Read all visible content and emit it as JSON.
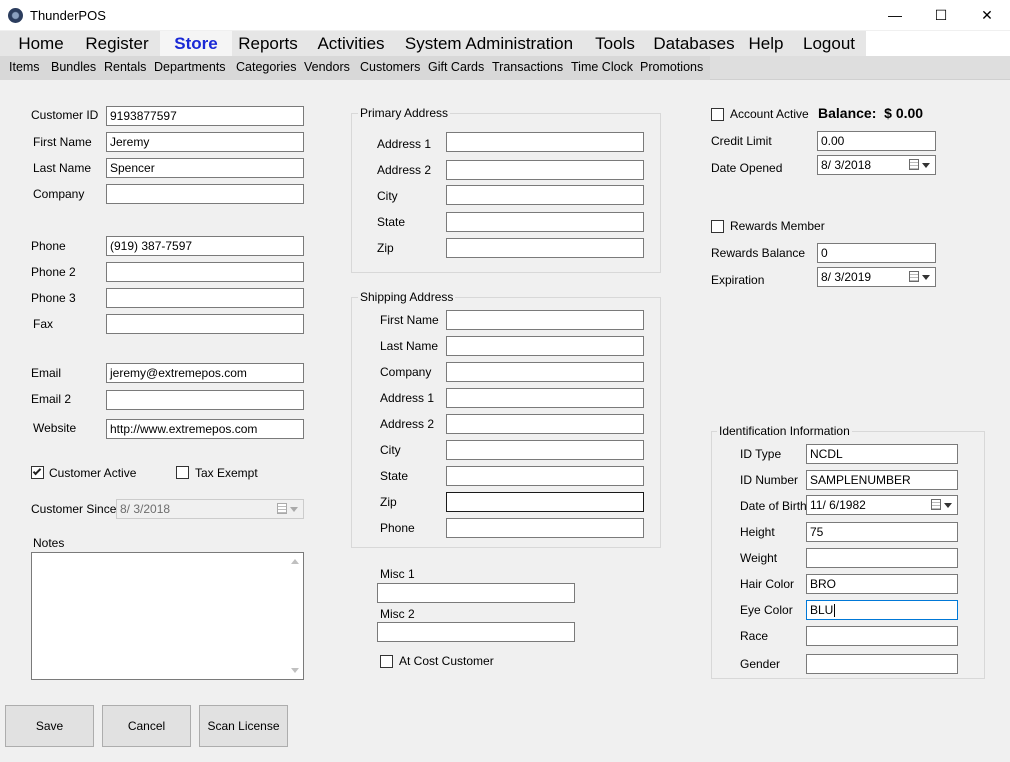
{
  "window": {
    "title": "ThunderPOS",
    "minimize": "—",
    "maximize": "☐",
    "close": "✕"
  },
  "main_menu": [
    "Home",
    "Register",
    "Store",
    "Reports",
    "Activities",
    "System Administration",
    "Tools",
    "Databases",
    "Help",
    "Logout"
  ],
  "main_menu_active": "Store",
  "sub_menu": [
    "Items",
    "Bundles",
    "Rentals",
    "Departments",
    "Categories",
    "Vendors",
    "Customers",
    "Gift Cards",
    "Transactions",
    "Time Clock",
    "Promotions"
  ],
  "customer": {
    "id_label": "Customer ID",
    "id": "9193877597",
    "first_name_label": "First Name",
    "first_name": "Jeremy",
    "last_name_label": "Last Name",
    "last_name": "Spencer",
    "company_label": "Company",
    "company": "",
    "phone_label": "Phone",
    "phone": "(919) 387-7597",
    "phone2_label": "Phone 2",
    "phone2": "",
    "phone3_label": "Phone 3",
    "phone3": "",
    "fax_label": "Fax",
    "fax": "",
    "email_label": "Email",
    "email": "jeremy@extremepos.com",
    "email2_label": "Email 2",
    "email2": "",
    "website_label": "Website",
    "website": "http://www.extremepos.com",
    "active_label": "Customer Active",
    "active": true,
    "tax_exempt_label": "Tax Exempt",
    "tax_exempt": false,
    "since_label": "Customer Since",
    "since": "8/  3/2018",
    "notes_label": "Notes",
    "notes": ""
  },
  "primary_address": {
    "title": "Primary Address",
    "address1_label": "Address 1",
    "address1": "",
    "address2_label": "Address 2",
    "address2": "",
    "city_label": "City",
    "city": "",
    "state_label": "State",
    "state": "",
    "zip_label": "Zip",
    "zip": ""
  },
  "shipping_address": {
    "title": "Shipping Address",
    "first_name_label": "First Name",
    "first_name": "",
    "last_name_label": "Last Name",
    "last_name": "",
    "company_label": "Company",
    "company": "",
    "address1_label": "Address 1",
    "address1": "",
    "address2_label": "Address 2",
    "address2": "",
    "city_label": "City",
    "city": "",
    "state_label": "State",
    "state": "",
    "zip_label": "Zip",
    "zip": "",
    "phone_label": "Phone",
    "phone": ""
  },
  "misc": {
    "misc1_label": "Misc 1",
    "misc1": "",
    "misc2_label": "Misc 2",
    "misc2": "",
    "at_cost_label": "At Cost Customer",
    "at_cost": false
  },
  "account": {
    "active_label": "Account Active",
    "active": false,
    "balance_label": "Balance:",
    "balance_currency": "$",
    "balance": "0.00",
    "credit_limit_label": "Credit Limit",
    "credit_limit": "0.00",
    "date_opened_label": "Date Opened",
    "date_opened": "8/  3/2018"
  },
  "rewards": {
    "member_label": "Rewards Member",
    "member": false,
    "balance_label": "Rewards Balance",
    "balance": "0",
    "expiration_label": "Expiration",
    "expiration": "8/  3/2019"
  },
  "identification": {
    "title": "Identification Information",
    "id_type_label": "ID Type",
    "id_type": "NCDL",
    "id_number_label": "ID Number",
    "id_number": "SAMPLENUMBER",
    "dob_label": "Date of Birth",
    "dob": "11/  6/1982",
    "height_label": "Height",
    "height": "75",
    "weight_label": "Weight",
    "weight": "",
    "hair_color_label": "Hair Color",
    "hair_color": "BRO",
    "eye_color_label": "Eye Color",
    "eye_color": "BLU",
    "race_label": "Race",
    "race": "",
    "gender_label": "Gender",
    "gender": ""
  },
  "buttons": {
    "save": "Save",
    "cancel": "Cancel",
    "scan_license": "Scan License"
  },
  "colors": {
    "active_menu_text": "#1a29d6",
    "focus_border": "#0078d7"
  }
}
